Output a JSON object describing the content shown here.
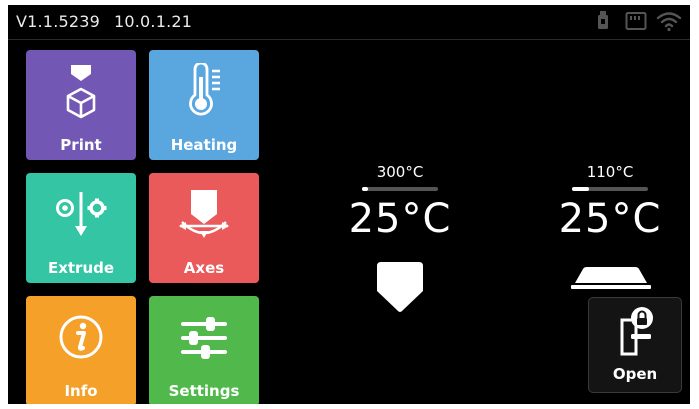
{
  "status_bar": {
    "version": "V1.1.5239",
    "ip": "10.0.1.21",
    "icons": [
      "usb-icon",
      "sd-card-icon",
      "wifi-icon"
    ]
  },
  "menu": {
    "tiles": [
      {
        "label": "Print",
        "icon": "print-icon",
        "color": "#7258b4"
      },
      {
        "label": "Heating",
        "icon": "thermometer-icon",
        "color": "#5aa7df"
      },
      {
        "label": "Extrude",
        "icon": "extrude-icon",
        "color": "#34c5a4"
      },
      {
        "label": "Axes",
        "icon": "axes-icon",
        "color": "#eb5a5a"
      },
      {
        "label": "Info",
        "icon": "info-icon",
        "color": "#f4a029"
      },
      {
        "label": "Settings",
        "icon": "settings-sliders-icon",
        "color": "#51b94c"
      }
    ]
  },
  "temperatures": {
    "hotend": {
      "target": "300°C",
      "current": "25°C",
      "progress": 0.08,
      "icon": "hotend-icon"
    },
    "bed": {
      "target": "110°C",
      "current": "25°C",
      "progress": 0.23,
      "icon": "heated-bed-icon"
    }
  },
  "door": {
    "label": "Open",
    "icon": "door-lock-icon"
  },
  "colors": {
    "background": "#000000",
    "text": "#ffffff",
    "progress_track": "#555555"
  }
}
